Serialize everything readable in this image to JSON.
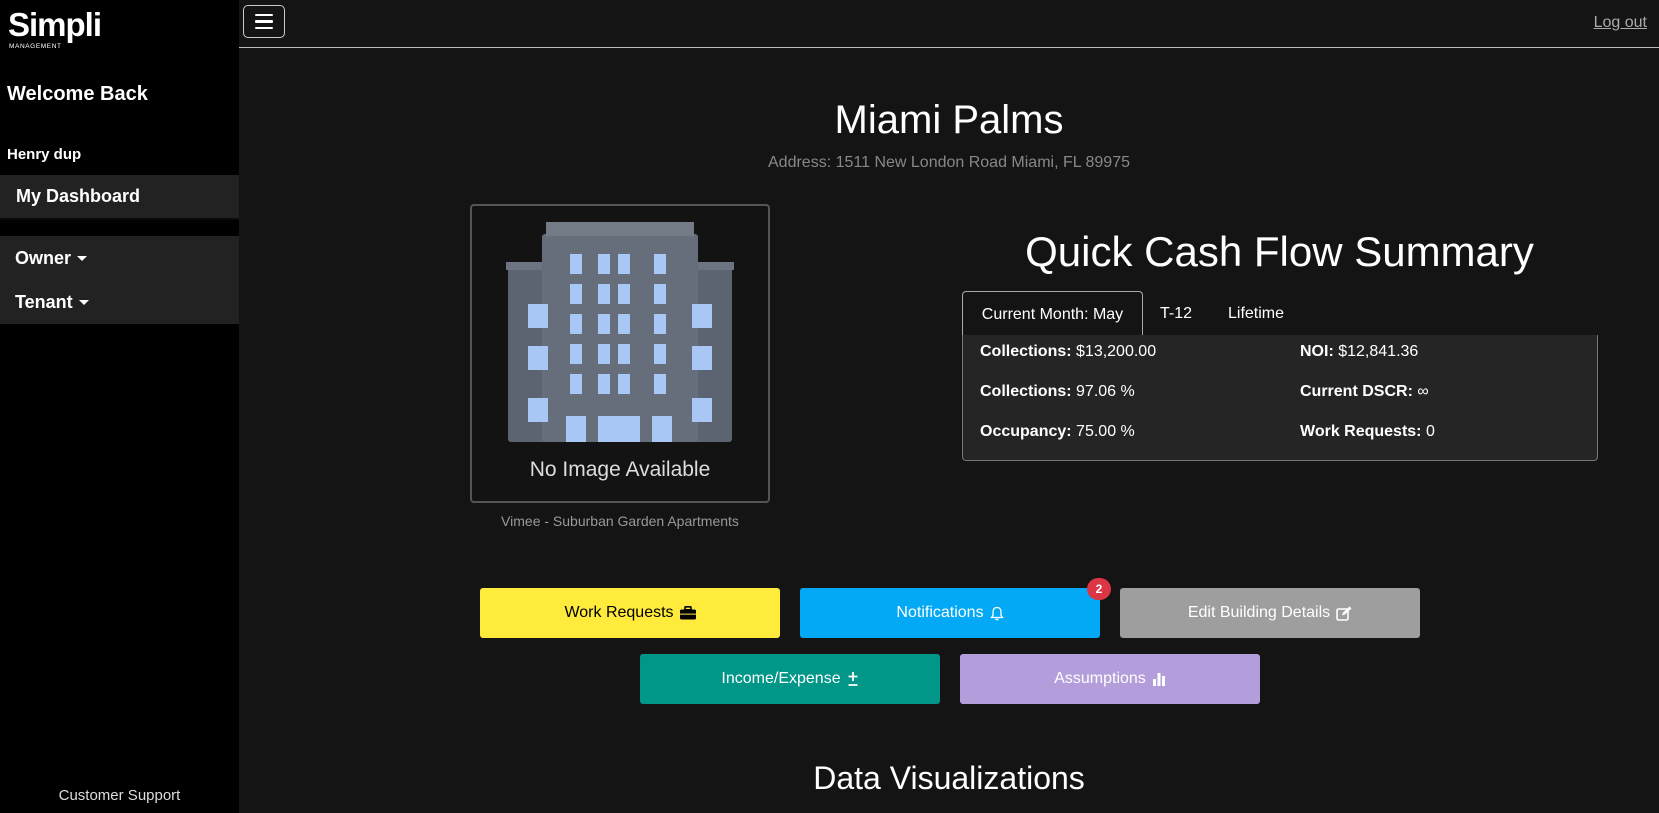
{
  "sidebar": {
    "logo": {
      "word": "Simpli",
      "sub": "MANAGEMENT"
    },
    "welcome": "Welcome Back",
    "username": "Henry dup",
    "dashboard_label": "My Dashboard",
    "menu": [
      {
        "label": "Owner"
      },
      {
        "label": "Tenant"
      }
    ],
    "support_label": "Customer Support"
  },
  "topbar": {
    "logout_label": "Log out"
  },
  "property": {
    "name": "Miami Palms",
    "address": "Address: 1511 New London Road Miami, FL 89975",
    "no_image_text": "No Image Available",
    "image_caption": "Vimee - Suburban Garden Apartments"
  },
  "cash_flow": {
    "title": "Quick Cash Flow Summary",
    "tabs": [
      "Current Month: May",
      "T-12",
      "Lifetime"
    ],
    "active_tab": "Current Month: May",
    "stats": [
      {
        "label": "Collections:",
        "value": "$13,200.00"
      },
      {
        "label": "NOI:",
        "value": "$12,841.36"
      },
      {
        "label": "Collections:",
        "value": "97.06 %"
      },
      {
        "label": "Current DSCR:",
        "value": "∞"
      },
      {
        "label": "Occupancy:",
        "value": "75.00 %"
      },
      {
        "label": "Work Requests:",
        "value": "0"
      }
    ]
  },
  "actions": {
    "work_requests": {
      "label": "Work Requests",
      "icon": "briefcase-icon",
      "color": "#ffeb3b"
    },
    "notifications": {
      "label": "Notifications",
      "icon": "bell-icon",
      "color": "#03a9f4",
      "badge": "2"
    },
    "edit_building": {
      "label": "Edit Building Details",
      "icon": "edit-icon",
      "color": "#9e9e9e"
    },
    "income_expense": {
      "label": "Income/Expense",
      "icon": "plus-minus-icon",
      "color": "#009688"
    },
    "assumptions": {
      "label": "Assumptions",
      "icon": "bar-chart-icon",
      "color": "#b39ddb"
    }
  },
  "section_title": "Data Visualizations"
}
